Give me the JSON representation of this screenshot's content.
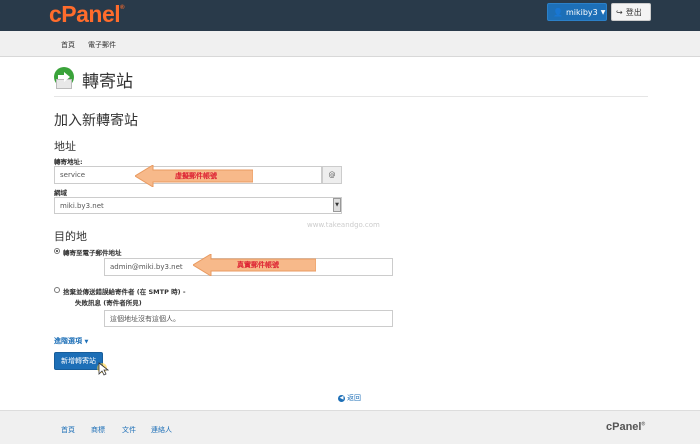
{
  "header": {
    "logo": "cPanel",
    "logo_mark": "®",
    "username": "mikiby3",
    "logout": "登出"
  },
  "nav": {
    "items": [
      "首頁",
      "電子郵件"
    ]
  },
  "page": {
    "title": "轉寄站"
  },
  "form": {
    "heading": "加入新轉寄站",
    "address_heading": "地址",
    "forward_address_label": "轉寄地址:",
    "forward_address_value": "service",
    "at_symbol": "@",
    "domain_label": "網域",
    "domain_value": "miki.by3.net",
    "destination_heading": "目的地",
    "forward_to_email_label": "轉寄至電子郵件地址",
    "forward_to_email_value": "admin@miki.by3.net",
    "discard_label": "捨棄並傳送錯誤給寄件者 (在 SMTP 時) -",
    "fail_message_label": "失敗訊息 (寄件者所見)",
    "fail_message_placeholder": "這個地址沒有這個人。",
    "advanced_options": "進階選項",
    "submit": "新增轉寄站",
    "back": "返回"
  },
  "annotations": {
    "virtual_account": "虛擬郵件帳號",
    "real_account": "真實郵件帳號"
  },
  "watermark": "www.takeandgo.com",
  "footer": {
    "links": [
      "首頁",
      "商標",
      "文件",
      "連絡人"
    ],
    "logo": "cPanel",
    "logo_mark": "®"
  },
  "colors": {
    "topbar": "#293a4a",
    "accent": "#1d6fb7",
    "brand_orange": "#ff6c2c",
    "annotation_arrow": "#f7b98a"
  }
}
